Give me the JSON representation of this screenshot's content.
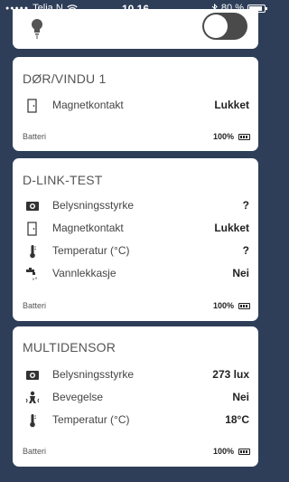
{
  "status_bar": {
    "signal": "●●●●●",
    "carrier": "Telia N",
    "time": "10.16",
    "battery_percent": "80 %"
  },
  "top_card": {
    "toggle_on": false
  },
  "cards": [
    {
      "title": "DØR/VINDU 1",
      "rows": [
        {
          "icon": "door-icon",
          "label": "Magnetkontakt",
          "value": "Lukket"
        }
      ],
      "battery_label": "Batteri",
      "battery_value": "100%"
    },
    {
      "title": "D-LINK-TEST",
      "rows": [
        {
          "icon": "light-sensor-icon",
          "label": "Belysningsstyrke",
          "value": "?"
        },
        {
          "icon": "door-icon",
          "label": "Magnetkontakt",
          "value": "Lukket"
        },
        {
          "icon": "thermometer-icon",
          "label": "Temperatur (°C)",
          "value": "?"
        },
        {
          "icon": "water-leak-icon",
          "label": "Vannlekkasje",
          "value": "Nei"
        }
      ],
      "battery_label": "Batteri",
      "battery_value": "100%"
    },
    {
      "title": "MULTIDENSOR",
      "rows": [
        {
          "icon": "light-sensor-icon",
          "label": "Belysningsstyrke",
          "value": "273 lux"
        },
        {
          "icon": "motion-icon",
          "label": "Bevegelse",
          "value": "Nei"
        },
        {
          "icon": "thermometer-icon",
          "label": "Temperatur (°C)",
          "value": "18°C"
        }
      ],
      "battery_label": "Batteri",
      "battery_value": "100%"
    }
  ]
}
